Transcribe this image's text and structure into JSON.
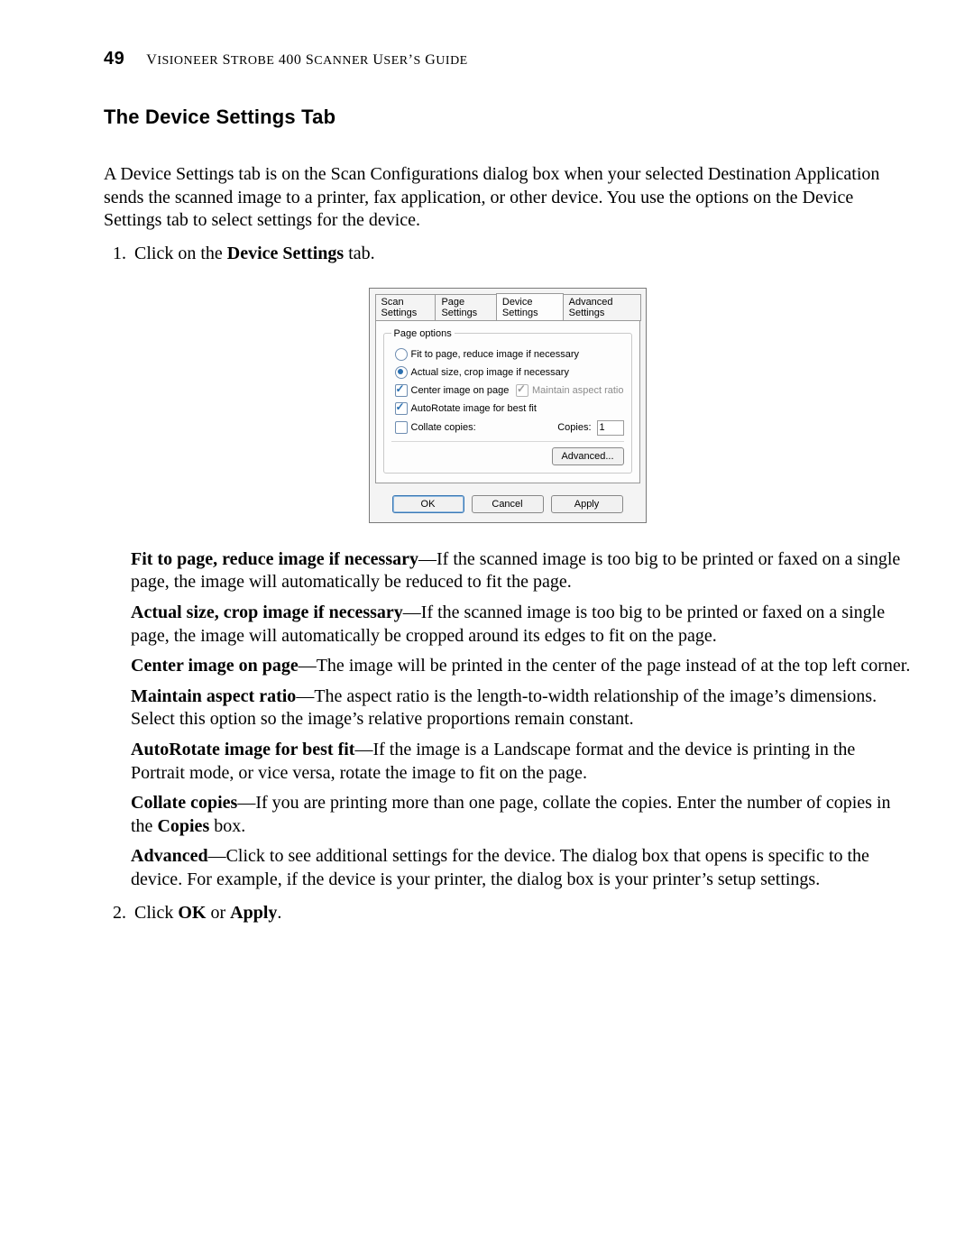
{
  "header": {
    "page_number": "49",
    "running_head_pre": "V",
    "running_head_sc1": "ISIONEER",
    "running_head_mid1": " S",
    "running_head_sc2": "TROBE",
    "running_head_mid2": " 400 S",
    "running_head_sc3": "CANNER",
    "running_head_mid3": " U",
    "running_head_sc4": "SER",
    "running_head_mid4": "’",
    "running_head_sc5": "S",
    "running_head_mid5": " G",
    "running_head_sc6": "UIDE"
  },
  "section_title": "The Device Settings Tab",
  "intro": "A Device Settings tab is on the Scan Configurations dialog box when your selected Destination Application sends the scanned image to a printer, fax application, or other device. You use the options on the Device Settings tab to select settings for the device.",
  "step1_pre": "Click on the ",
  "step1_bold": "Device Settings",
  "step1_post": " tab.",
  "dialog": {
    "tabs": {
      "scan": "Scan Settings",
      "page": "Page Settings",
      "device": "Device Settings",
      "advanced": "Advanced Settings"
    },
    "group_legend": "Page options",
    "opt_fit": "Fit to page, reduce image if necessary",
    "opt_actual": "Actual size, crop image if necessary",
    "chk_center": "Center image on page",
    "chk_maintain": "Maintain aspect ratio",
    "chk_autorotate": "AutoRotate image for best fit",
    "chk_collate": "Collate copies:",
    "copies_label": "Copies:",
    "copies_value": "1",
    "btn_advanced": "Advanced...",
    "btn_ok": "OK",
    "btn_cancel": "Cancel",
    "btn_apply": "Apply"
  },
  "defs": {
    "d1_b": "Fit to page, reduce image if necessary",
    "d1_t": "—If the scanned image is too big to be printed or faxed on a single page, the image will automatically be reduced to fit the page.",
    "d2_b": "Actual size, crop image if necessary",
    "d2_t": "—If the scanned image is too big to be printed or faxed on a single page, the image will automatically be cropped around its edges to fit on the page.",
    "d3_b": "Center image on page",
    "d3_t": "—The image will be printed in the center of the page instead of at the top left corner.",
    "d4_b": "Maintain aspect ratio",
    "d4_t": "—The aspect ratio is the length-to-width relationship of the image’s dimensions. Select this option so the image’s relative proportions remain constant.",
    "d5_b": "AutoRotate image for best fit",
    "d5_t": "—If the image is a Landscape format and the device is printing in the Portrait mode, or vice versa, rotate the image to fit on the page.",
    "d6_b": "Collate copies",
    "d6_t1": "—If you are printing more than one page, collate the copies. Enter the number of copies in the ",
    "d6_b2": "Copies",
    "d6_t2": " box.",
    "d7_b": "Advanced",
    "d7_t": "—Click to see additional settings for the device. The dialog box that opens is specific to the device. For example, if the device is your printer, the dialog box is your printer’s setup settings."
  },
  "step2_pre": "Click ",
  "step2_ok": "OK",
  "step2_mid": " or ",
  "step2_apply": "Apply",
  "step2_post": "."
}
